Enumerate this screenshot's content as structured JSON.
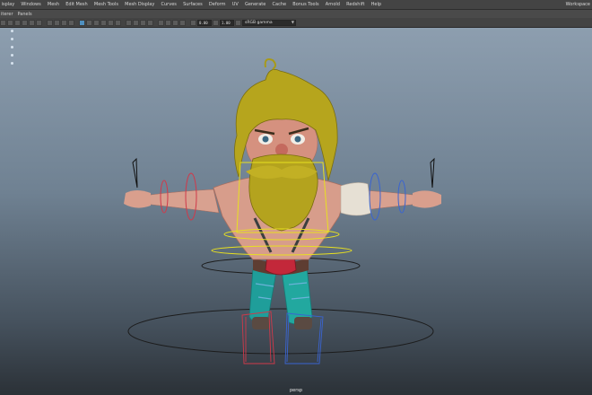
{
  "menubar": {
    "items": [
      "isplay",
      "Windows",
      "Mesh",
      "Edit Mesh",
      "Mesh Tools",
      "Mesh Display",
      "Curves",
      "Surfaces",
      "Deform",
      "UV",
      "Generate",
      "Cache",
      "Bonus Tools",
      "Arnold",
      "Redshift",
      "Help"
    ],
    "workspace_label": "Workspace"
  },
  "panel_menu": {
    "items": [
      "iterer",
      "Panels"
    ]
  },
  "toolbar": {
    "field_a": "0.00",
    "field_b": "1.00",
    "color_space": "sRGB gamma",
    "highlight_color": "#4f8fbf"
  },
  "viewport": {
    "camera_label": "persp",
    "background_top": "#8d9eaf",
    "background_bottom": "#2b3137"
  }
}
